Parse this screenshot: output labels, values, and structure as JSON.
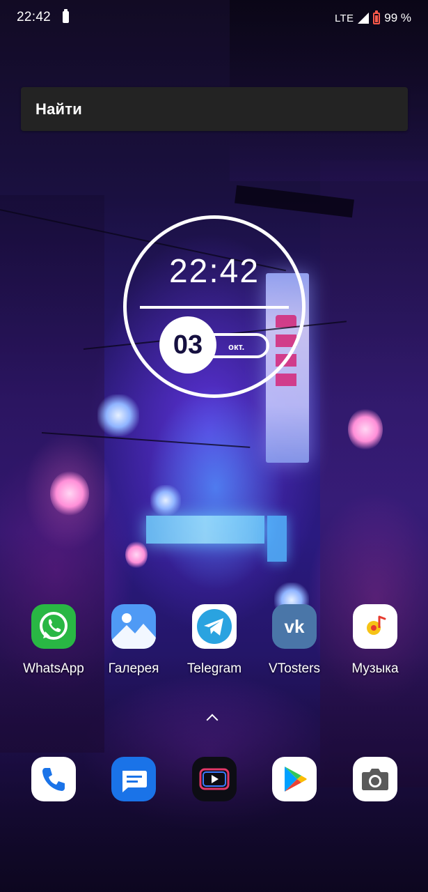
{
  "status_bar": {
    "time": "22:42",
    "network": "LTE",
    "battery": "99 %"
  },
  "search": {
    "label": "Найти"
  },
  "clock_widget": {
    "time": "22:42",
    "day": "03",
    "month": "окт."
  },
  "apps": [
    {
      "label": "WhatsApp",
      "icon": "whatsapp-icon"
    },
    {
      "label": "Галерея",
      "icon": "gallery-icon"
    },
    {
      "label": "Telegram",
      "icon": "telegram-icon"
    },
    {
      "label": "VTosters",
      "icon": "vk-icon"
    },
    {
      "label": "Музыка",
      "icon": "music-icon"
    }
  ],
  "dock": [
    {
      "icon": "phone-icon"
    },
    {
      "icon": "messages-icon"
    },
    {
      "icon": "video-player-icon"
    },
    {
      "icon": "play-store-icon"
    },
    {
      "icon": "camera-icon"
    }
  ],
  "colors": {
    "search_bg": "#232323",
    "whatsapp": "#29b744",
    "gallery": "#4f9af5",
    "telegram": "#2aa3e0",
    "vk": "#4a76a8",
    "messages": "#1a73e8",
    "battery_low": "#ff5a4a"
  }
}
